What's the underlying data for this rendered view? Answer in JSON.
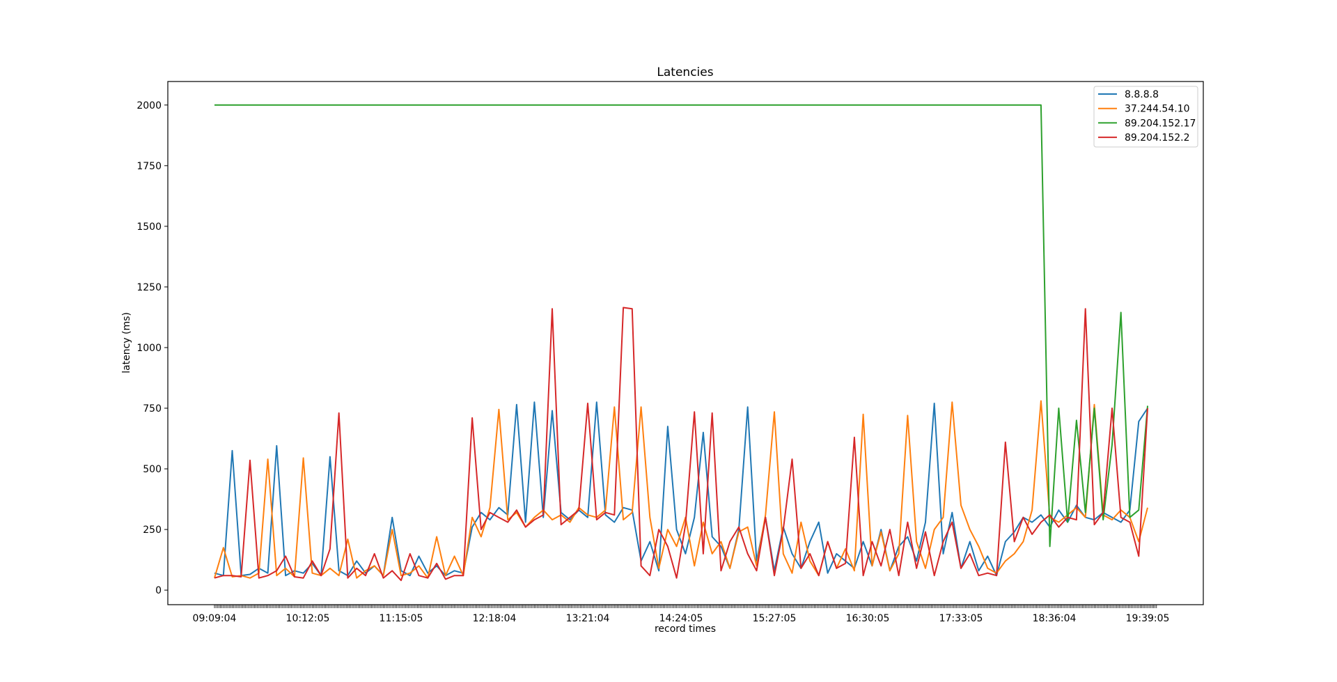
{
  "chart_data": {
    "type": "line",
    "title": "Latencies",
    "xlabel": "record times",
    "ylabel": "latency (ms)",
    "x_point_count": 637,
    "sample_step": 6,
    "xlim": [
      -31.5,
      667.6
    ],
    "ylim": [
      -60,
      2097
    ],
    "yticks": [
      0,
      250,
      500,
      750,
      1000,
      1250,
      1500,
      1750,
      2000
    ],
    "xtick_labels": [
      {
        "index": 0,
        "label": "09:09:04"
      },
      {
        "index": 63,
        "label": "10:12:05"
      },
      {
        "index": 126,
        "label": "11:15:05"
      },
      {
        "index": 189,
        "label": "12:18:04"
      },
      {
        "index": 252,
        "label": "13:21:04"
      },
      {
        "index": 315,
        "label": "14:24:05"
      },
      {
        "index": 378,
        "label": "15:27:05"
      },
      {
        "index": 441,
        "label": "16:30:05"
      },
      {
        "index": 504,
        "label": "17:33:05"
      },
      {
        "index": 567,
        "label": "18:36:04"
      },
      {
        "index": 630,
        "label": "19:39:05"
      }
    ],
    "grid": false,
    "legend_position": "top-right",
    "series": [
      {
        "name": "8.8.8.8",
        "color": "#1f77b4",
        "values": [
          70,
          60,
          575,
          60,
          65,
          90,
          70,
          595,
          60,
          80,
          70,
          110,
          60,
          550,
          80,
          60,
          120,
          70,
          100,
          60,
          300,
          80,
          60,
          140,
          70,
          100,
          60,
          80,
          70,
          260,
          320,
          290,
          340,
          310,
          765,
          280,
          775,
          300,
          740,
          320,
          290,
          330,
          300,
          775,
          310,
          280,
          340,
          330,
          120,
          200,
          80,
          675,
          250,
          150,
          300,
          650,
          220,
          180,
          90,
          250,
          755,
          120,
          300,
          80,
          260,
          150,
          90,
          200,
          280,
          70,
          150,
          120,
          90,
          200,
          100,
          250,
          80,
          180,
          220,
          120,
          280,
          770,
          150,
          320,
          90,
          200,
          80,
          140,
          60,
          200,
          240,
          300,
          280,
          310,
          260,
          330,
          280,
          350,
          300,
          290,
          320,
          300,
          280,
          330,
          695,
          750
        ]
      },
      {
        "name": "37.244.54.10",
        "color": "#ff7f0e",
        "values": [
          50,
          175,
          55,
          60,
          50,
          70,
          540,
          60,
          90,
          55,
          545,
          70,
          60,
          90,
          60,
          210,
          50,
          80,
          100,
          60,
          250,
          60,
          70,
          100,
          50,
          220,
          60,
          140,
          60,
          300,
          220,
          340,
          745,
          290,
          320,
          260,
          300,
          330,
          290,
          310,
          280,
          340,
          310,
          300,
          330,
          755,
          290,
          320,
          755,
          300,
          90,
          250,
          180,
          300,
          100,
          280,
          150,
          200,
          90,
          240,
          260,
          100,
          310,
          735,
          150,
          70,
          280,
          120,
          60,
          200,
          90,
          170,
          80,
          725,
          100,
          240,
          80,
          150,
          720,
          200,
          90,
          250,
          300,
          775,
          350,
          250,
          180,
          90,
          70,
          120,
          150,
          200,
          330,
          780,
          300,
          280,
          310,
          340,
          300,
          765,
          310,
          290,
          330,
          300,
          200,
          340
        ]
      },
      {
        "name": "89.204.152.17",
        "color": "#2ca02c",
        "values": [
          2000,
          2000,
          2000,
          2000,
          2000,
          2000,
          2000,
          2000,
          2000,
          2000,
          2000,
          2000,
          2000,
          2000,
          2000,
          2000,
          2000,
          2000,
          2000,
          2000,
          2000,
          2000,
          2000,
          2000,
          2000,
          2000,
          2000,
          2000,
          2000,
          2000,
          2000,
          2000,
          2000,
          2000,
          2000,
          2000,
          2000,
          2000,
          2000,
          2000,
          2000,
          2000,
          2000,
          2000,
          2000,
          2000,
          2000,
          2000,
          2000,
          2000,
          2000,
          2000,
          2000,
          2000,
          2000,
          2000,
          2000,
          2000,
          2000,
          2000,
          2000,
          2000,
          2000,
          2000,
          2000,
          2000,
          2000,
          2000,
          2000,
          2000,
          2000,
          2000,
          2000,
          2000,
          2000,
          2000,
          2000,
          2000,
          2000,
          2000,
          2000,
          2000,
          2000,
          2000,
          2000,
          2000,
          2000,
          2000,
          2000,
          2000,
          2000,
          2000,
          2000,
          2000,
          180,
          750,
          280,
          700,
          320,
          750,
          290,
          600,
          1145,
          300,
          330,
          760
        ]
      },
      {
        "name": "89.204.152.2",
        "color": "#d62728",
        "values": [
          50,
          60,
          60,
          55,
          535,
          50,
          60,
          80,
          140,
          55,
          50,
          120,
          60,
          170,
          730,
          50,
          90,
          60,
          150,
          50,
          80,
          40,
          150,
          60,
          50,
          110,
          45,
          60,
          60,
          710,
          250,
          320,
          300,
          280,
          330,
          260,
          290,
          310,
          1160,
          270,
          300,
          330,
          770,
          290,
          320,
          310,
          1165,
          1160,
          100,
          60,
          250,
          180,
          50,
          270,
          735,
          150,
          730,
          80,
          200,
          260,
          150,
          80,
          300,
          60,
          250,
          540,
          90,
          150,
          60,
          200,
          90,
          110,
          630,
          60,
          200,
          100,
          250,
          60,
          280,
          90,
          240,
          60,
          200,
          280,
          90,
          150,
          60,
          70,
          60,
          610,
          200,
          300,
          230,
          280,
          310,
          260,
          300,
          290,
          1160,
          270,
          320,
          750,
          300,
          280,
          140,
          750
        ]
      }
    ]
  }
}
